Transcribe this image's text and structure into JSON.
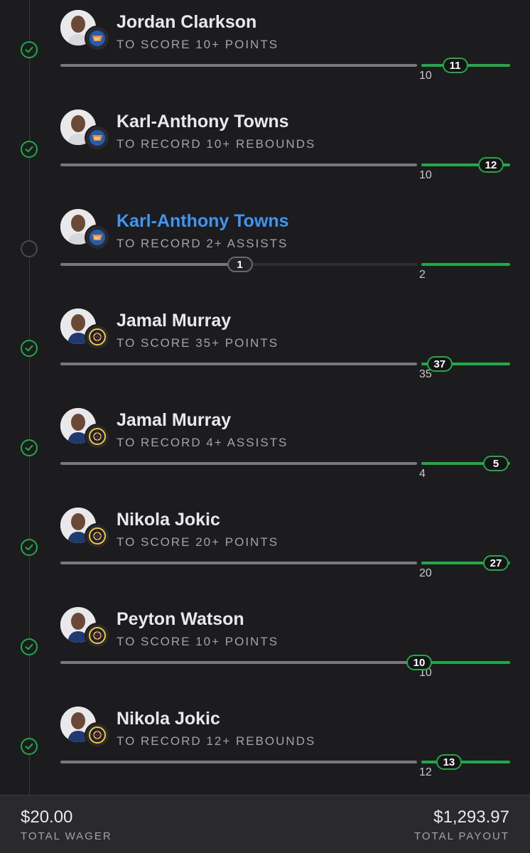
{
  "legs": [
    {
      "player": "Jordan Clarkson",
      "prop": "TO SCORE 10+ POINTS",
      "target": "10",
      "current": "11",
      "progress": 1.1,
      "status": "done",
      "live": false,
      "team": "knicks"
    },
    {
      "player": "Karl-Anthony Towns",
      "prop": "TO RECORD 10+ REBOUNDS",
      "target": "10",
      "current": "12",
      "progress": 1.2,
      "status": "done",
      "live": false,
      "team": "knicks"
    },
    {
      "player": "Karl-Anthony Towns",
      "prop": "TO RECORD 2+ ASSISTS",
      "target": "2",
      "current": "1",
      "progress": 0.5,
      "status": "pending",
      "live": true,
      "team": "knicks"
    },
    {
      "player": "Jamal Murray",
      "prop": "TO SCORE 35+ POINTS",
      "target": "35",
      "current": "37",
      "progress": 1.057,
      "status": "done",
      "live": false,
      "team": "nuggets"
    },
    {
      "player": "Jamal Murray",
      "prop": "TO RECORD 4+ ASSISTS",
      "target": "4",
      "current": "5",
      "progress": 1.25,
      "status": "done",
      "live": false,
      "team": "nuggets"
    },
    {
      "player": "Nikola Jokic",
      "prop": "TO SCORE 20+ POINTS",
      "target": "20",
      "current": "27",
      "progress": 1.35,
      "status": "done",
      "live": false,
      "team": "nuggets"
    },
    {
      "player": "Peyton Watson",
      "prop": "TO SCORE 10+ POINTS",
      "target": "10",
      "current": "10",
      "progress": 1.0,
      "status": "done",
      "live": false,
      "team": "nuggets"
    },
    {
      "player": "Nikola Jokic",
      "prop": "TO RECORD 12+ REBOUNDS",
      "target": "12",
      "current": "13",
      "progress": 1.083,
      "status": "done",
      "live": false,
      "team": "nuggets"
    }
  ],
  "footer": {
    "wager_amount": "$20.00",
    "wager_label": "TOTAL WAGER",
    "payout_amount": "$1,293.97",
    "payout_label": "TOTAL PAYOUT"
  },
  "icons": {
    "check": "check-circle-icon",
    "pending": "empty-circle-icon",
    "knicks": "knicks-logo",
    "nuggets": "nuggets-logo"
  },
  "colors": {
    "background": "#1c1c1e",
    "accent_green": "#1faa47",
    "live_blue": "#3f95f2",
    "track_grey": "#79797d",
    "footer_bg": "#2a2a2c"
  }
}
